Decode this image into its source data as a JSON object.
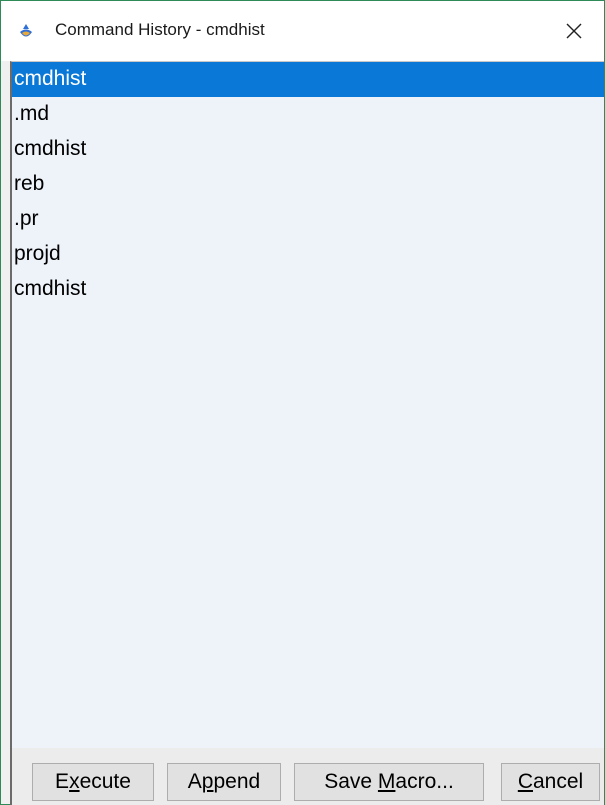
{
  "window": {
    "title": "Command History - cmdhist",
    "icon": "drop-app-icon",
    "close_icon": "close-icon",
    "border_color": "#2e8b57"
  },
  "list": {
    "selected_index": 0,
    "selection_color": "#0a78d7",
    "items": [
      {
        "label": "cmdhist"
      },
      {
        "label": ".md"
      },
      {
        "label": "cmdhist"
      },
      {
        "label": "reb"
      },
      {
        "label": ".pr"
      },
      {
        "label": "projd"
      },
      {
        "label": "cmdhist"
      }
    ]
  },
  "buttons": {
    "execute": {
      "pre": "E",
      "mnemonic": "x",
      "post": "ecute"
    },
    "append": {
      "pre": "A",
      "mnemonic": "p",
      "post": "pend"
    },
    "save_macro": {
      "pre": "Save ",
      "mnemonic": "M",
      "post": "acro..."
    },
    "cancel": {
      "pre": "",
      "mnemonic": "C",
      "post": "ancel"
    }
  }
}
